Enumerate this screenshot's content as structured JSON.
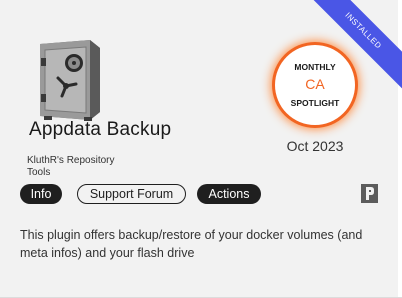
{
  "plugin": {
    "name": "Appdata Backup",
    "author": "KluthR's Repository",
    "category": "Tools",
    "description": "This plugin offers backup/restore of your docker volumes (and meta infos) and your flash drive"
  },
  "badge": {
    "installed_label": "INSTALLED",
    "color": "#4a56e6"
  },
  "spotlight": {
    "top_label": "MONTHLY",
    "mid_label": "CA",
    "bottom_label": "SPOTLIGHT",
    "date": "Oct 2023",
    "accent_color": "#f26522"
  },
  "actions": {
    "info_label": "Info",
    "support_label": "Support Forum",
    "actions_label": "Actions"
  },
  "icons": {
    "app_icon": "safe-icon",
    "plugin_type": "plugin-icon"
  }
}
